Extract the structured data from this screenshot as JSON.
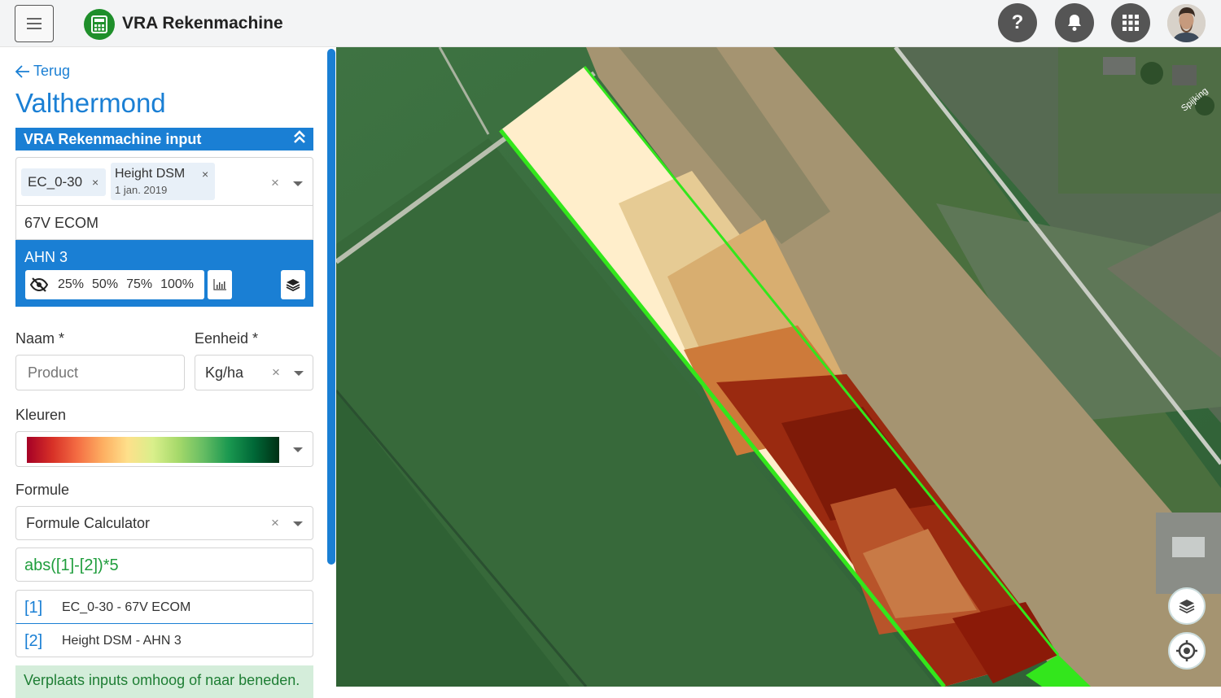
{
  "header": {
    "app_title": "VRA Rekenmachine",
    "help_label": "?",
    "icons": [
      "menu-icon",
      "calculator-icon",
      "help-icon",
      "bell-icon",
      "apps-grid-icon"
    ]
  },
  "sidebar": {
    "back_label": "Terug",
    "title": "Valthermond",
    "section_title": "VRA Rekenmachine input",
    "tags": [
      {
        "label": "EC_0-30"
      },
      {
        "label": "Height DSM",
        "sub": "1 jan. 2019"
      }
    ],
    "tag_remove": "×",
    "clear_glyph": "×",
    "layers": [
      {
        "label": "67V ECOM",
        "selected": false
      },
      {
        "label": "AHN 3",
        "selected": true
      }
    ],
    "opacity_options": [
      "25%",
      "50%",
      "75%",
      "100%"
    ],
    "naam_label": "Naam *",
    "naam_placeholder": "Product",
    "eenheid_label": "Eenheid *",
    "eenheid_value": "Kg/ha",
    "kleuren_label": "Kleuren",
    "formule_label": "Formule",
    "formule_value": "Formule Calculator",
    "formula": "abs([1]-[2])*5",
    "variables": [
      {
        "index": "[1]",
        "value": "EC_0-30 - 67V ECOM"
      },
      {
        "index": "[2]",
        "value": "Height DSM - AHN 3"
      }
    ],
    "info": "Verplaats inputs omhoog of naar beneden."
  },
  "map": {
    "place_label": "Spijking",
    "controls": [
      "layers-icon",
      "locate-icon"
    ]
  }
}
